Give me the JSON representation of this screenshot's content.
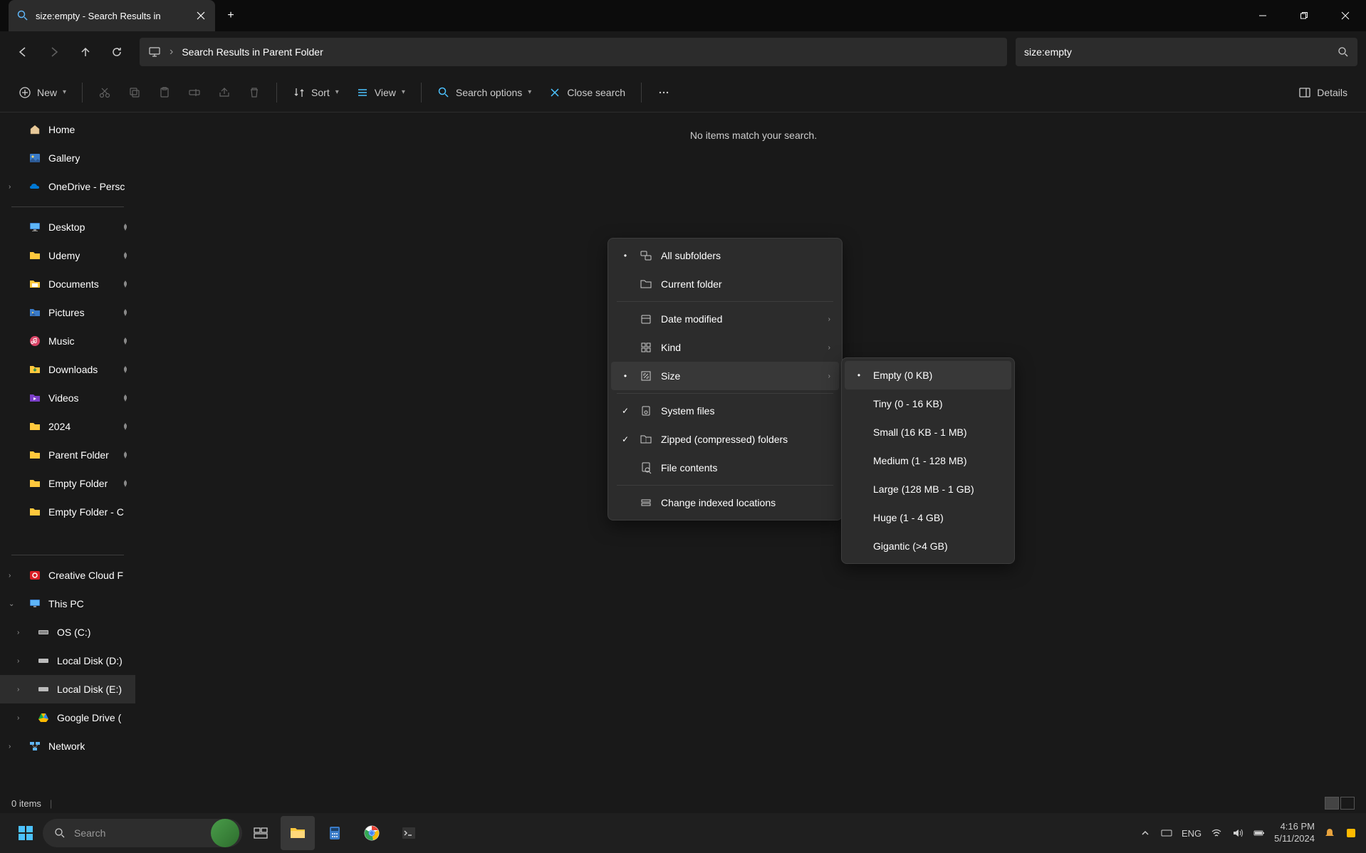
{
  "tab": {
    "title": "size:empty - Search Results in"
  },
  "address": {
    "text": "Search Results in Parent Folder"
  },
  "search": {
    "value": "size:empty"
  },
  "toolbar": {
    "new": "New",
    "sort": "Sort",
    "view": "View",
    "search_options": "Search options",
    "close_search": "Close search",
    "details": "Details"
  },
  "sidebar": {
    "home": "Home",
    "gallery": "Gallery",
    "onedrive": "OneDrive - Persc",
    "pinned": [
      {
        "label": "Desktop"
      },
      {
        "label": "Udemy"
      },
      {
        "label": "Documents"
      },
      {
        "label": "Pictures"
      },
      {
        "label": "Music"
      },
      {
        "label": "Downloads"
      },
      {
        "label": "Videos"
      },
      {
        "label": "2024"
      },
      {
        "label": "Parent Folder"
      },
      {
        "label": "Empty Folder"
      },
      {
        "label": "Empty Folder - C"
      }
    ],
    "creative": "Creative Cloud F",
    "thispc": "This PC",
    "drives": [
      {
        "label": "OS (C:)"
      },
      {
        "label": "Local Disk (D:)"
      },
      {
        "label": "Local Disk (E:)"
      },
      {
        "label": "Google Drive ("
      }
    ],
    "network": "Network"
  },
  "content": {
    "no_items": "No items match your search."
  },
  "ctx_primary": {
    "items": [
      {
        "label": "All subfolders",
        "bullet": true
      },
      {
        "label": "Current folder"
      },
      {
        "label": "Date modified",
        "sub": true
      },
      {
        "label": "Kind",
        "sub": true
      },
      {
        "label": "Size",
        "sub": true,
        "bullet": true,
        "highlighted": true
      },
      {
        "label": "System files",
        "check": true
      },
      {
        "label": "Zipped (compressed) folders",
        "check": true
      },
      {
        "label": "File contents"
      },
      {
        "label": "Change indexed locations"
      }
    ]
  },
  "ctx_sub": {
    "items": [
      {
        "label": "Empty (0 KB)",
        "bullet": true,
        "highlighted": true
      },
      {
        "label": "Tiny (0 - 16 KB)"
      },
      {
        "label": "Small (16 KB - 1 MB)"
      },
      {
        "label": "Medium (1 - 128 MB)"
      },
      {
        "label": "Large (128 MB - 1 GB)"
      },
      {
        "label": "Huge (1 - 4 GB)"
      },
      {
        "label": "Gigantic (>4 GB)"
      }
    ]
  },
  "status": {
    "items": "0 items"
  },
  "taskbar": {
    "search": "Search",
    "lang": "ENG",
    "time": "4:16 PM",
    "date": "5/11/2024"
  }
}
